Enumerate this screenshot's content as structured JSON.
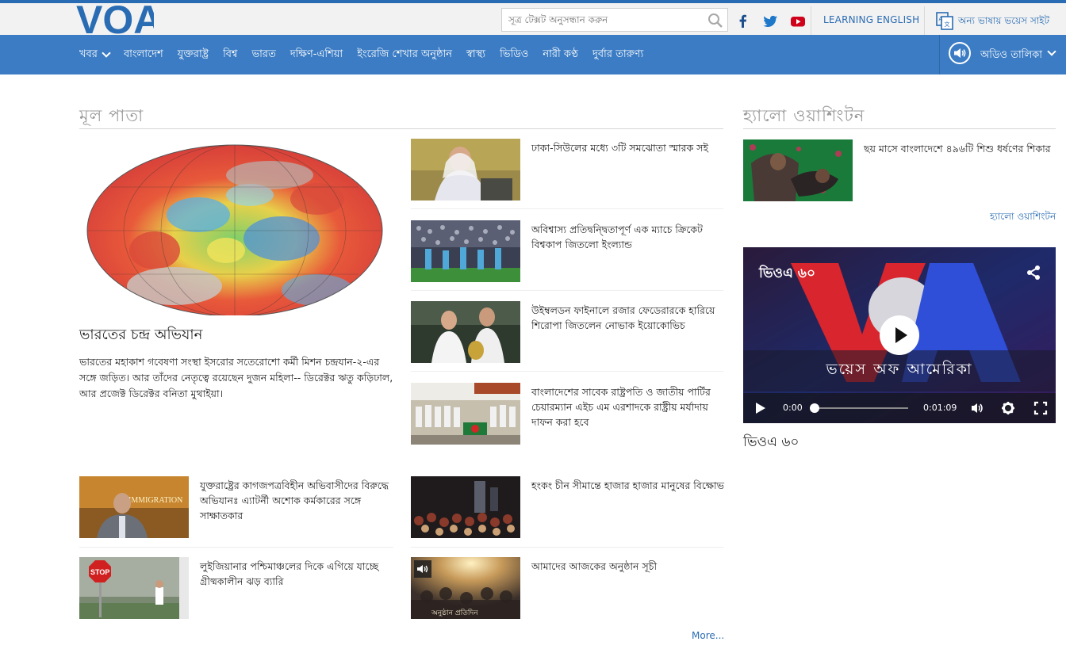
{
  "header": {
    "logo_text": "VOA",
    "search_placeholder": "সূত্র টেক্সট অনুসন্ধান করুন",
    "social_icons": [
      "facebook-icon",
      "twitter-icon",
      "youtube-icon"
    ],
    "learning_english": "LEARNING ENGLISH",
    "other_languages": "অন্য ভাষায় ভয়েস সাইট"
  },
  "nav": {
    "items": [
      "খবর",
      "বাংলাদেশ",
      "যুক্তরাষ্ট্র",
      "বিশ্ব",
      "ভারত",
      "দক্ষিণ-এশিয়া",
      "ইংরেজি শেখার অনুষ্ঠান",
      "স্বাস্থ্য",
      "ভিডিও",
      "নারী কণ্ঠ",
      "দুর্বার তারুণ্য"
    ],
    "audio_label": "অডিও তালিকা"
  },
  "main": {
    "section_title": "মূল পাতা",
    "lead": {
      "title": "ভারতের চন্দ্র অভিযান",
      "description": "ভারতের মহাকাশ গবেষণা সংস্থা ইসরোর সতেরোশো কর্মী মিশন চন্দ্রযান-২-এর সঙ্গে জড়িত। আর তাঁদের নেতৃত্বে রয়েছেন দুজন মহিলা-- ডিরেক্টর ঋতু কড়িঢাল, আর প্রজেক্ট ডিরেক্টর বনিতা মুথাইয়া।"
    },
    "right_stories": [
      {
        "title": "ঢাকা-সিউলের মধ্যে ৩টি সমঝোতা স্মারক সই"
      },
      {
        "title": "অবিশ্বাস্য প্রতিদ্বন্দ্বিতাপূর্ণ এক ম্যাচে ক্রিকেট বিশ্বকাপ জিতলো ইংল্যান্ড"
      },
      {
        "title": "উইম্বলডন ফাইনালে রজার ফেডেরারকে হারিয়ে শিরোপা জিতলেন নোভাক ইয়োকোভিচ"
      },
      {
        "title": "বাংলাদেশের সাবেক রাষ্ট্রপতি ও জাতীয় পার্টির চেয়ারম্যান এইচ এম এরশাদকে রাষ্ট্রীয় মর্যাদায় দাফন করা হবে"
      }
    ],
    "bottom_left": [
      {
        "title": "যুক্তরাষ্ট্রের কাগজপত্রবিহীন অভিবাসীদের বিরুদ্ধে অভিযানঃ এ্যাটর্নী অশোক কর্মকারের সঙ্গে সাক্ষাতকার",
        "thumb_text": "IMMIGRATION"
      },
      {
        "title": "লুইজিয়ানার পশ্চিমাঞ্চলের দিকে এগিয়ে যাচ্ছে গ্রীষ্মকালীন ঝড় ব্যারি",
        "thumb_text": "STOP"
      }
    ],
    "bottom_right": [
      {
        "title": "হংকং চীন সীমান্তে হাজার হাজার মানুষের বিক্ষোভ"
      },
      {
        "title": "আমাদের আজকের অনুষ্ঠান সূচী",
        "thumb_text": "অনুষ্ঠান প্রতিদিন"
      }
    ],
    "more_link": "More..."
  },
  "sidebar": {
    "section_title": "হ্যালো ওয়াশিংটন",
    "story": {
      "title": "ছয় মাসে বাংলাদেশে ৪৯৬টি শিশু ধর্ষণের শিকার"
    },
    "link": "হ্যালো ওয়াশিংটন",
    "video": {
      "title": "ভিওএ ৬০",
      "caption": "ভয়েস অফ আমেরিকা",
      "current_time": "0:00",
      "duration": "0:01:09",
      "progress": 0
    },
    "video_label": "ভিওএ ৬০"
  },
  "colors": {
    "nav_blue": "#3b7cc4",
    "top_border": "#2a6cb3",
    "link_blue": "#2a6cb3",
    "section_gray": "#9a9a9a"
  }
}
